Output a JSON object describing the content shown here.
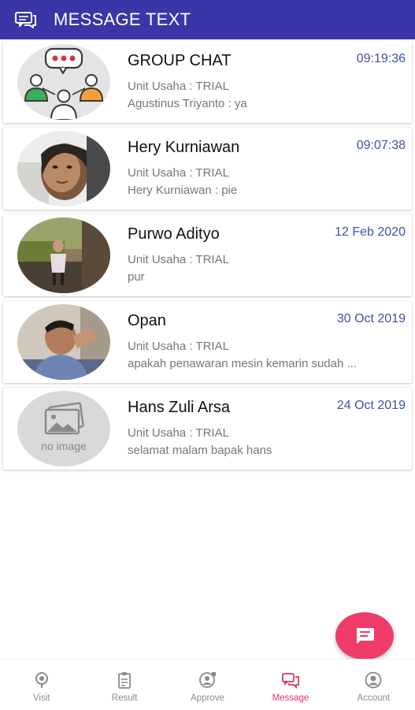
{
  "appbar": {
    "title": "MESSAGE TEXT",
    "icon": "chat-icon",
    "color": "#3A36A8"
  },
  "conversations": [
    {
      "name": "GROUP CHAT",
      "time": "09:19:36",
      "unit": "Unit Usaha :  TRIAL",
      "last_message": "Agustinus Triyanto : ya",
      "avatar": "group-chat-avatar"
    },
    {
      "name": "Hery Kurniawan",
      "time": "09:07:38",
      "unit": "Unit Usaha :  TRIAL",
      "last_message": "Hery Kurniawan : pie",
      "avatar": "user-photo"
    },
    {
      "name": "Purwo Adityo",
      "time": "12 Feb 2020",
      "unit": "Unit Usaha :  TRIAL",
      "last_message": "pur",
      "avatar": "user-photo"
    },
    {
      "name": "Opan",
      "time": "30 Oct 2019",
      "unit": "Unit Usaha :  TRIAL",
      "last_message": "apakah penawaran mesin kemarin sudah ...",
      "avatar": "user-photo"
    },
    {
      "name": "Hans Zuli Arsa",
      "time": "24 Oct 2019",
      "unit": "Unit Usaha :  TRIAL",
      "last_message": "selamat malam bapak hans",
      "avatar": "no-image",
      "avatar_text": "no image"
    }
  ],
  "fab": {
    "icon": "new-message-icon",
    "color": "#EE3B6A"
  },
  "bottom_nav": {
    "active": "Message",
    "active_color": "#D7385E",
    "items": [
      {
        "label": "Visit",
        "icon": "location-icon"
      },
      {
        "label": "Result",
        "icon": "clipboard-icon"
      },
      {
        "label": "Approve",
        "icon": "approve-user-icon"
      },
      {
        "label": "Message",
        "icon": "message-icon"
      },
      {
        "label": "Account",
        "icon": "account-icon"
      }
    ]
  }
}
